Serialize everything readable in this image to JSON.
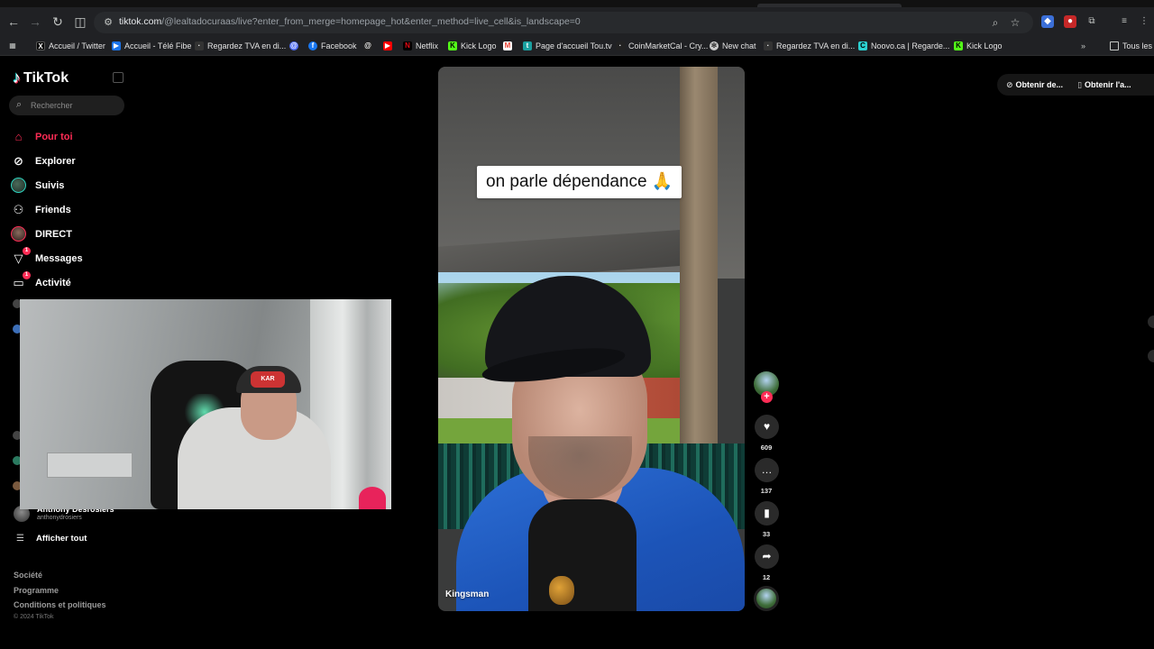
{
  "browser": {
    "url_host": "tiktok.com",
    "url_path": "/@lealtadocuraas/live?enter_from_merge=homepage_hot&enter_method=live_cell&is_landscape=0",
    "bookmarks": [
      {
        "label": "Accueil / Twitter",
        "icon": "x-icon",
        "color": "#000000"
      },
      {
        "label": "Accueil - Télé Fibe",
        "icon": "bell-fibe-icon",
        "color": "#1a73e8"
      },
      {
        "label": "Regardez TVA en di...",
        "icon": "tva-icon",
        "color": "#333333"
      },
      {
        "label": "",
        "icon": "messenger-icon",
        "color": "#4e6cf5"
      },
      {
        "label": "Facebook",
        "icon": "facebook-icon",
        "color": "#1877f2"
      },
      {
        "label": "",
        "icon": "threads-icon",
        "color": "#222222"
      },
      {
        "label": "",
        "icon": "youtube-icon",
        "color": "#ff0000"
      },
      {
        "label": "Netflix",
        "icon": "netflix-icon",
        "color": "#e50914"
      },
      {
        "label": "Kick Logo",
        "icon": "kick-icon",
        "color": "#53fc18"
      },
      {
        "label": "",
        "icon": "gmail-icon",
        "color": "#ea4335"
      },
      {
        "label": "Page d'accueil Tou.tv",
        "icon": "toutv-icon",
        "color": "#1aa0a0"
      },
      {
        "label": "CoinMarketCal - Cry...",
        "icon": "coinmarketcal-icon",
        "color": "#222222"
      },
      {
        "label": "New chat",
        "icon": "chatgpt-icon",
        "color": "#cccccc"
      },
      {
        "label": "Regardez TVA en di...",
        "icon": "tva-icon",
        "color": "#333333"
      },
      {
        "label": "Noovo.ca | Regarde...",
        "icon": "noovo-icon",
        "color": "#2bd0d0"
      },
      {
        "label": "Kick Logo",
        "icon": "kick-icon",
        "color": "#53fc18"
      }
    ],
    "all_bookmarks": "Tous les f"
  },
  "tiktok": {
    "logo": "TikTok",
    "search_placeholder": "Rechercher",
    "nav": [
      {
        "label": "Pour toi",
        "icon": "home-icon",
        "active": true
      },
      {
        "label": "Explorer",
        "icon": "compass-icon"
      },
      {
        "label": "Suivis",
        "icon": "following-avatar-icon"
      },
      {
        "label": "Friends",
        "icon": "friends-icon"
      },
      {
        "label": "DIRECT",
        "icon": "live-avatar-icon"
      },
      {
        "label": "Messages",
        "icon": "messages-icon",
        "badge": "1"
      },
      {
        "label": "Activité",
        "icon": "activity-icon",
        "badge": "1"
      }
    ],
    "followed_account": {
      "name": "Anthony Desrosiers",
      "handle": "anthonydrosiers"
    },
    "show_all": "Afficher tout",
    "footer": [
      "Société",
      "Programme",
      "Conditions et politiques"
    ],
    "copyright": "© 2024 TikTok",
    "get_app": [
      "Obtenir de...",
      "Obtenir l'a..."
    ]
  },
  "video": {
    "caption": "on parle dépendance 🙏",
    "author": "Kingsman",
    "likes": "609",
    "comments": "137",
    "saves": "33",
    "shares": "12"
  },
  "webcam": {
    "cap_text": "KAR"
  },
  "colors": {
    "accent": "#fe2c55",
    "teal": "#25f4ee",
    "chrome_bg": "#202124"
  }
}
